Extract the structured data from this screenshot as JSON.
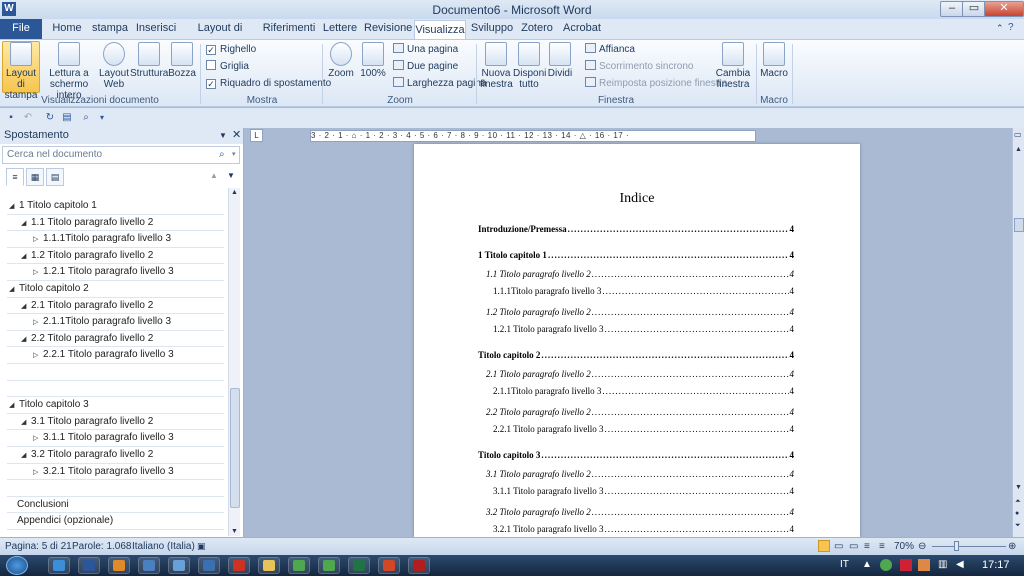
{
  "window": {
    "app_icon": "word-icon",
    "title": "Documento6 - Microsoft Word",
    "min": "–",
    "max": "▭",
    "close": "✕"
  },
  "tabs": [
    "File",
    "Home",
    "stampa",
    "Inserisci",
    "Layout di pagina",
    "Riferimenti",
    "Lettere",
    "Revisione",
    "Visualizza",
    "Sviluppo",
    "Zotero",
    "Acrobat"
  ],
  "active_tab": "Visualizza",
  "ribbon": {
    "views": {
      "layout_stampa": "Layout di stampa",
      "lettura": "Lettura a schermo intero",
      "layout_web": "Layout Web",
      "struttura": "Struttura",
      "bozza": "Bozza",
      "group": "Visualizzazioni documento"
    },
    "mostra": {
      "righello": "Righello",
      "griglia": "Griglia",
      "riquadro": "Riquadro di spostamento",
      "group": "Mostra"
    },
    "zoom": {
      "zoom": "Zoom",
      "cento": "100%",
      "una_pagina": "Una pagina",
      "due_pagine": "Due pagine",
      "larghezza": "Larghezza pagina",
      "group": "Zoom"
    },
    "finestra": {
      "nuova": "Nuova finestra",
      "disponi": "Disponi tutto",
      "dividi": "Dividi",
      "affianca": "Affianca",
      "scorrimento": "Scorrimento sincrono",
      "reimposta": "Reimposta posizione finestra",
      "cambia": "Cambia finestra",
      "group": "Finestra"
    },
    "macro": {
      "macro": "Macro",
      "group": "Macro"
    }
  },
  "nav": {
    "title": "Spostamento",
    "close": "✕",
    "search_placeholder": "Cerca nel documento",
    "items": [
      {
        "level": 1,
        "text": "1 Titolo capitolo 1"
      },
      {
        "level": 2,
        "text": "1.1 Titolo paragrafo livello 2"
      },
      {
        "level": 3,
        "text": "1.1.1Titolo paragrafo livello 3"
      },
      {
        "level": 2,
        "text": "1.2 Titolo paragrafo livello 2"
      },
      {
        "level": 3,
        "text": "1.2.1 Titolo paragrafo livello 3"
      },
      {
        "level": 1,
        "text": "Titolo capitolo 2"
      },
      {
        "level": 2,
        "text": "2.1 Titolo paragrafo livello 2"
      },
      {
        "level": 3,
        "text": "2.1.1Titolo paragrafo livello 3"
      },
      {
        "level": 2,
        "text": "2.2 Titolo paragrafo livello 2"
      },
      {
        "level": 3,
        "text": "2.2.1 Titolo paragrafo livello 3"
      },
      {
        "level": 0,
        "text": ""
      },
      {
        "level": 0,
        "text": ""
      },
      {
        "level": 1,
        "text": "Titolo capitolo 3"
      },
      {
        "level": 2,
        "text": "3.1 Titolo paragrafo livello 2"
      },
      {
        "level": 3,
        "text": "3.1.1 Titolo paragrafo livello 3"
      },
      {
        "level": 2,
        "text": "3.2 Titolo paragrafo livello 2"
      },
      {
        "level": 3,
        "text": "3.2.1 Titolo paragrafo livello 3"
      },
      {
        "level": 0,
        "text": ""
      },
      {
        "level": 0,
        "text": "Conclusioni"
      },
      {
        "level": 0,
        "text": "Appendici (opzionale)"
      }
    ]
  },
  "ruler": "3 · 2 · 1 · ⌂ · 1 · 2 · 3 · 4 · 5 · 6 · 7 · 8 · 9 · 10 · 11 · 12 · 13 · 14 · △ · 16 · 17 ·",
  "document": {
    "title": "Indice",
    "toc": [
      {
        "style": "b",
        "indent": 0,
        "text": "Introduzione/Premessa",
        "page": "4"
      },
      {
        "style": "b",
        "indent": 0,
        "text": "1 Titolo capitolo 1",
        "page": "4"
      },
      {
        "style": "i",
        "indent": 8,
        "text": "1.1 Titolo paragrafo livello 2",
        "page": "4"
      },
      {
        "style": "n",
        "indent": 15,
        "text": "1.1.1Titolo paragrafo livello 3",
        "page": "4"
      },
      {
        "style": "i",
        "indent": 8,
        "text": "1.2 Titolo paragrafo livello 2",
        "page": "4"
      },
      {
        "style": "n",
        "indent": 15,
        "text": "1.2.1 Titolo paragrafo livello 3",
        "page": "4"
      },
      {
        "style": "b",
        "indent": 0,
        "text": "Titolo capitolo 2",
        "page": "4"
      },
      {
        "style": "i",
        "indent": 8,
        "text": "2.1 Titolo paragrafo livello 2",
        "page": "4"
      },
      {
        "style": "n",
        "indent": 15,
        "text": "2.1.1Titolo paragrafo livello 3",
        "page": "4"
      },
      {
        "style": "i",
        "indent": 8,
        "text": "2.2 Titolo paragrafo livello 2",
        "page": "4"
      },
      {
        "style": "n",
        "indent": 15,
        "text": "2.2.1 Titolo paragrafo livello 3",
        "page": "4"
      },
      {
        "style": "b",
        "indent": 0,
        "text": "Titolo capitolo 3",
        "page": "4"
      },
      {
        "style": "i",
        "indent": 8,
        "text": "3.1 Titolo paragrafo livello 2",
        "page": "4"
      },
      {
        "style": "n",
        "indent": 15,
        "text": "3.1.1 Titolo paragrafo livello 3",
        "page": "4"
      },
      {
        "style": "i",
        "indent": 8,
        "text": "3.2 Titolo paragrafo livello 2",
        "page": "4"
      },
      {
        "style": "n",
        "indent": 15,
        "text": "3.2.1 Titolo paragrafo livello 3",
        "page": "4"
      }
    ]
  },
  "status": {
    "page": "Pagina: 5 di 21",
    "words": "Parole: 1.068",
    "language": "Italiano (Italia)",
    "zoom": "70%"
  },
  "taskbar": {
    "lang": "IT",
    "time": "17:17",
    "apps": [
      "ie-icon",
      "word-icon",
      "media-icon",
      "network-icon",
      "tool-icon",
      "remote-icon",
      "acrobat-icon",
      "folder-icon",
      "chrome-icon",
      "chrome-icon",
      "excel-icon",
      "powerpoint-icon",
      "acrobat-reader-icon"
    ]
  }
}
